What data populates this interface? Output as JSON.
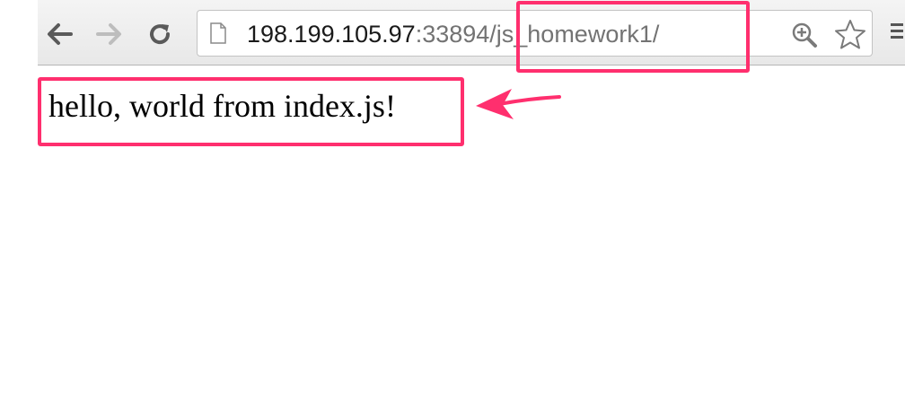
{
  "browser": {
    "url_host": "198.199.105.97",
    "url_rest": ":33894/js_homework1/",
    "icons": {
      "back": "back-arrow-icon",
      "forward": "forward-arrow-icon",
      "reload": "reload-icon",
      "page": "page-document-icon",
      "zoom": "zoom-icon",
      "bookmark": "star-icon",
      "menu": "menu-icon"
    }
  },
  "page": {
    "text": "hello, world from index.js!"
  },
  "annotations": {
    "color": "#ff2f6e"
  }
}
